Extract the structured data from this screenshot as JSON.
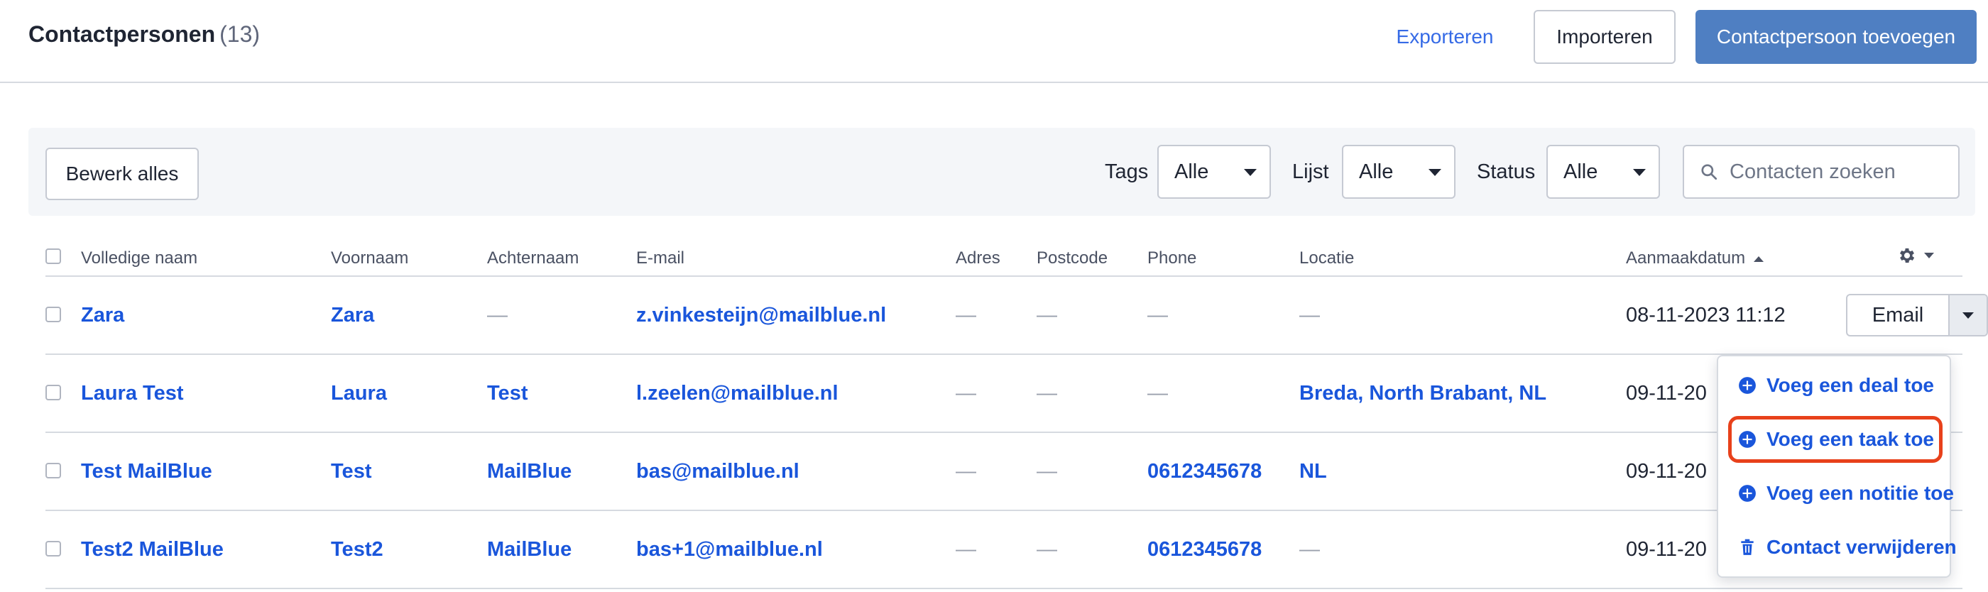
{
  "header": {
    "title": "Contactpersonen",
    "count": "(13)",
    "export_label": "Exporteren",
    "import_label": "Importeren",
    "add_label": "Contactpersoon toevoegen"
  },
  "filters": {
    "bulk_edit_label": "Bewerk alles",
    "tags_label": "Tags",
    "tags_value": "Alle",
    "list_label": "Lijst",
    "list_value": "Alle",
    "status_label": "Status",
    "status_value": "Alle",
    "search_placeholder": "Contacten zoeken"
  },
  "table": {
    "columns": [
      "Volledige naam",
      "Voornaam",
      "Achternaam",
      "E-mail",
      "Adres",
      "Postcode",
      "Phone",
      "Locatie",
      "Aanmaakdatum"
    ],
    "sort_column": "Aanmaakdatum",
    "sort_direction": "ascending",
    "rows": [
      {
        "full_name": "Zara",
        "first_name": "Zara",
        "last_name": "—",
        "email": "z.vinkesteijn@mailblue.nl",
        "address": "—",
        "postcode": "—",
        "phone": "—",
        "location": "—",
        "created": "08-11-2023 11:12"
      },
      {
        "full_name": "Laura Test",
        "first_name": "Laura",
        "last_name": "Test",
        "email": "l.zeelen@mailblue.nl",
        "address": "—",
        "postcode": "—",
        "phone": "—",
        "location": "Breda, North Brabant, NL",
        "created": "09-11-20"
      },
      {
        "full_name": "Test MailBlue",
        "first_name": "Test",
        "last_name": "MailBlue",
        "email": "bas@mailblue.nl",
        "address": "—",
        "postcode": "—",
        "phone": "0612345678",
        "location": "NL",
        "created": "09-11-20"
      },
      {
        "full_name": "Test2 MailBlue",
        "first_name": "Test2",
        "last_name": "MailBlue",
        "email": "bas+1@mailblue.nl",
        "address": "—",
        "postcode": "—",
        "phone": "0612345678",
        "location": "—",
        "created": "09-11-20"
      }
    ],
    "row_action_label": "Email"
  },
  "menu": {
    "items": [
      {
        "label": "Voeg een deal toe",
        "icon": "plus-circle-icon"
      },
      {
        "label": "Voeg een taak toe",
        "icon": "plus-circle-icon",
        "highlighted": true
      },
      {
        "label": "Voeg een notitie toe",
        "icon": "plus-circle-icon"
      },
      {
        "label": "Contact verwijderen",
        "icon": "trash-icon"
      }
    ]
  },
  "colors": {
    "link": "#1a56db",
    "primary_button": "#4f7fc2",
    "highlight_border": "#e8411b"
  }
}
